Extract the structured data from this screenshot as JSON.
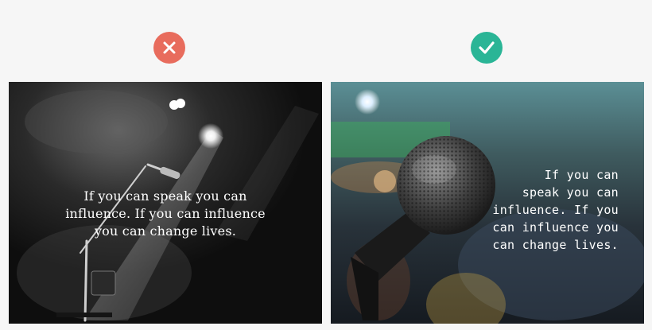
{
  "comparison": {
    "bad": {
      "icon": "x-icon",
      "color": "#e86c5d",
      "quote_lines": [
        "If you can speak you can",
        "influence. If you can influence",
        "you can change lives."
      ]
    },
    "good": {
      "icon": "check-icon",
      "color": "#2ab596",
      "quote_lines": [
        "If you can",
        "speak you can",
        "influence. If you",
        "can influence you",
        "can change lives."
      ]
    }
  }
}
